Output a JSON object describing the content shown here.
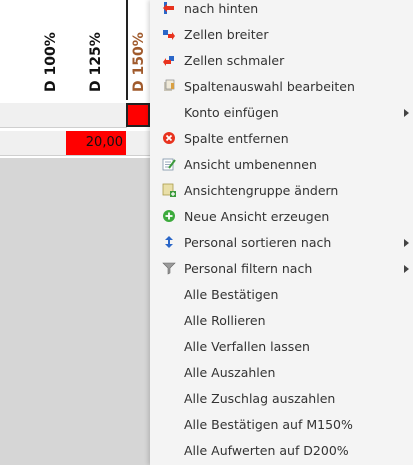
{
  "columns": [
    {
      "label": "D 100%"
    },
    {
      "label": "D 125%"
    },
    {
      "label": "D 150%"
    }
  ],
  "cells": {
    "row2_d125": "20,00"
  },
  "menu": {
    "items": [
      {
        "label": "nach hinten",
        "icon": "move-back-icon",
        "submenu": false
      },
      {
        "label": "Zellen breiter",
        "icon": "widen-cells-icon",
        "submenu": false
      },
      {
        "label": "Zellen schmaler",
        "icon": "narrow-cells-icon",
        "submenu": false
      },
      {
        "label": "Spaltenauswahl bearbeiten",
        "icon": "edit-columns-icon",
        "submenu": false
      },
      {
        "label": "Konto einfügen",
        "icon": "",
        "submenu": true
      },
      {
        "label": "Spalte entfernen",
        "icon": "remove-column-icon",
        "submenu": false
      },
      {
        "label": "Ansicht umbenennen",
        "icon": "rename-view-icon",
        "submenu": false
      },
      {
        "label": "Ansichtengruppe ändern",
        "icon": "change-view-group-icon",
        "submenu": false
      },
      {
        "label": "Neue Ansicht erzeugen",
        "icon": "new-view-icon",
        "submenu": false
      },
      {
        "label": "Personal sortieren nach",
        "icon": "sort-icon",
        "submenu": true
      },
      {
        "label": "Personal filtern nach",
        "icon": "filter-icon",
        "submenu": true
      },
      {
        "label": "Alle Bestätigen",
        "icon": "",
        "submenu": false
      },
      {
        "label": "Alle Rollieren",
        "icon": "",
        "submenu": false
      },
      {
        "label": "Alle Verfallen lassen",
        "icon": "",
        "submenu": false
      },
      {
        "label": "Alle Auszahlen",
        "icon": "",
        "submenu": false
      },
      {
        "label": "Alle Zuschlag auszahlen",
        "icon": "",
        "submenu": false
      },
      {
        "label": "Alle Bestätigen auf M150%",
        "icon": "",
        "submenu": false
      },
      {
        "label": "Alle Aufwerten auf D200%",
        "icon": "",
        "submenu": false
      }
    ]
  },
  "colors": {
    "highlight_red": "#ff0000",
    "menu_background": "#f4f4f4",
    "grid_background": "#d6d6d6"
  }
}
